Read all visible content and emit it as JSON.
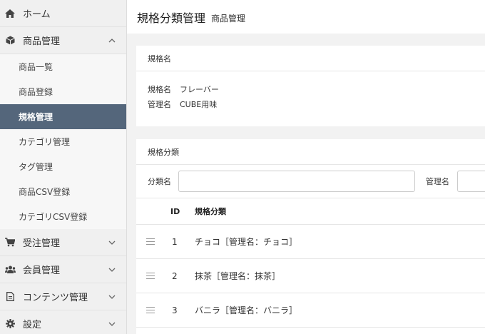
{
  "sidebar": {
    "home": "ホーム",
    "product": {
      "label": "商品管理",
      "items": [
        "商品一覧",
        "商品登録",
        "規格管理",
        "カテゴリ管理",
        "タグ管理",
        "商品CSV登録",
        "カテゴリCSV登録"
      ]
    },
    "order": "受注管理",
    "customer": "会員管理",
    "content": "コンテンツ管理",
    "settings": "設定"
  },
  "header": {
    "title": "規格分類管理",
    "subtitle": "商品管理"
  },
  "spec": {
    "heading": "規格名",
    "name_label": "規格名",
    "name_value": "フレーバー",
    "admin_label": "管理名",
    "admin_value": "CUBE用味"
  },
  "classes": {
    "heading": "規格分類",
    "search_class_label": "分類名",
    "search_admin_label": "管理名",
    "columns": {
      "id": "ID",
      "name": "規格分類"
    },
    "rows": [
      {
        "id": "1",
        "name": "チョコ［管理名：チョコ］"
      },
      {
        "id": "2",
        "name": "抹茶［管理名：抹茶］"
      },
      {
        "id": "3",
        "name": "バニラ［管理名：バニラ］"
      }
    ]
  }
}
